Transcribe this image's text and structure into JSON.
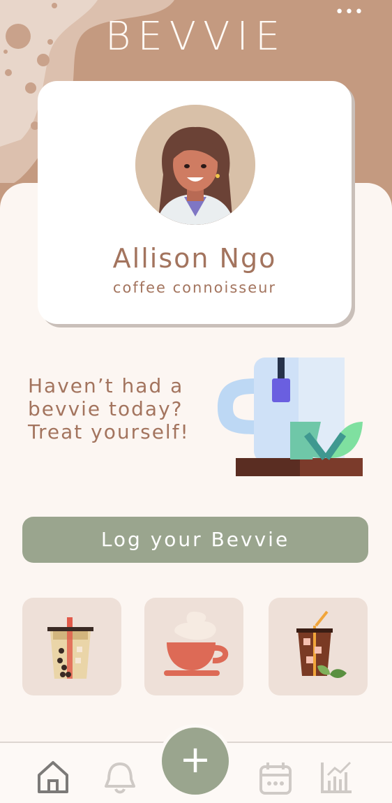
{
  "app": {
    "title": "BEVVIE",
    "more_menu": "•••"
  },
  "profile": {
    "name": "Allison Ngo",
    "subtitle": "coffee connoisseur"
  },
  "promo": {
    "text": "Haven’t had a bevvie today? Treat yourself!"
  },
  "actions": {
    "log_button": "Log your Bevvie",
    "add_button": "+"
  },
  "drinks": [
    {
      "name": "boba-tea"
    },
    {
      "name": "hot-coffee"
    },
    {
      "name": "iced-coffee"
    }
  ],
  "tabs": [
    {
      "id": "home",
      "icon": "home-icon",
      "active": true
    },
    {
      "id": "notifications",
      "icon": "bell-icon",
      "active": false
    },
    {
      "id": "calendar",
      "icon": "calendar-icon",
      "active": false
    },
    {
      "id": "stats",
      "icon": "chart-icon",
      "active": false
    }
  ],
  "colors": {
    "accent": "#9aa58e",
    "brand_brown": "#a3745e",
    "header_bg": "#c49a80",
    "background": "#fcf6f2",
    "tile_bg": "#eee0d8"
  }
}
